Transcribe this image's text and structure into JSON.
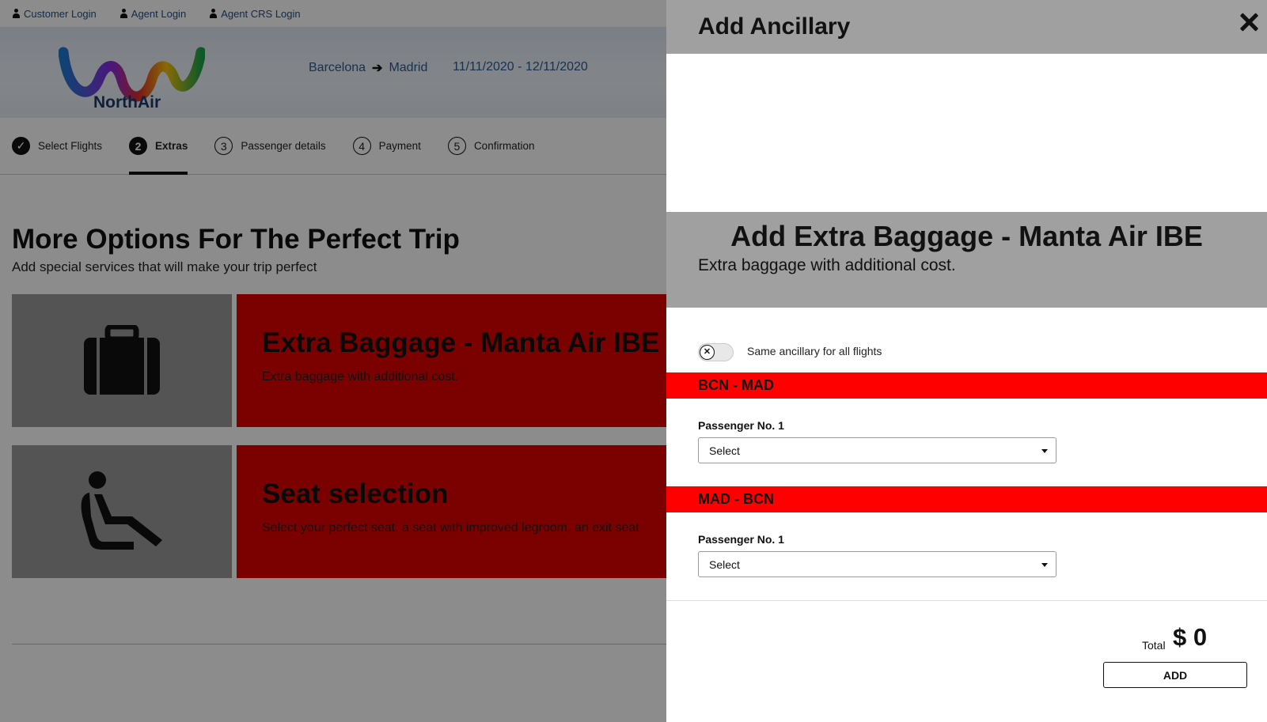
{
  "topbar": {
    "links": [
      {
        "label": "Customer Login",
        "icon": "person-icon"
      },
      {
        "label": "Agent Login",
        "icon": "person-icon"
      },
      {
        "label": "Agent CRS Login",
        "icon": "person-icon"
      }
    ]
  },
  "header": {
    "logo_text": "NorthAir",
    "route_from": "Barcelona",
    "route_arrow": "➔",
    "route_to": "Madrid",
    "dates": "11/11/2020 - 12/11/2020"
  },
  "steps": [
    {
      "number": "✓",
      "label": "Select Flights",
      "state": "completed"
    },
    {
      "number": "2",
      "label": "Extras",
      "state": "active"
    },
    {
      "number": "3",
      "label": "Passenger details",
      "state": "pending"
    },
    {
      "number": "4",
      "label": "Payment",
      "state": "pending"
    },
    {
      "number": "5",
      "label": "Confirmation",
      "state": "pending"
    }
  ],
  "main": {
    "title": "More Options For The Perfect Trip",
    "subtitle": "Add special services that will make your trip perfect",
    "cards": [
      {
        "icon": "suitcase-icon",
        "title": "Extra Baggage - Manta Air IBE",
        "description": "Extra baggage with additional cost."
      },
      {
        "icon": "seat-icon",
        "title": "Seat selection",
        "description": "Select your perfect seat, a seat with improved legroom, an exit seat"
      }
    ]
  },
  "panel": {
    "title": "Add Ancillary",
    "close_icon": "close-icon",
    "extra_title": "Add Extra Baggage - Manta Air IBE",
    "extra_desc": "Extra baggage with additional cost.",
    "toggle_label": "Same ancillary for all flights",
    "toggle_on": false,
    "legs": [
      {
        "route": "BCN - MAD",
        "passenger_label": "Passenger No. 1",
        "selected": "Select"
      },
      {
        "route": "MAD - BCN",
        "passenger_label": "Passenger No. 1",
        "selected": "Select"
      }
    ],
    "total_label": "Total",
    "total_value": "$ 0",
    "add_label": "ADD"
  },
  "colors": {
    "accent_red": "#ff0000",
    "card_red": "#e00000",
    "panel_gray": "#a0a0a0",
    "link_blue": "#1f4f8a"
  }
}
